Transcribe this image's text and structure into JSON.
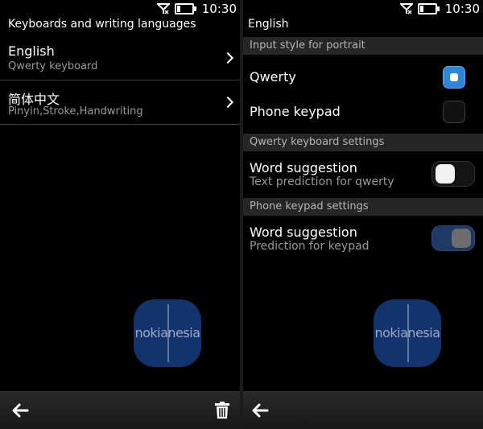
{
  "status": {
    "time": "10:30"
  },
  "left": {
    "title": "Keyboards and writing languages",
    "items": [
      {
        "label": "English",
        "sub": "Qwerty keyboard"
      },
      {
        "label": "简体中文",
        "sub": "Pinyin,Stroke,Handwriting"
      }
    ]
  },
  "right": {
    "title": "English",
    "sections": [
      {
        "header": "Input style for portrait"
      },
      {
        "header": "Qwerty keyboard settings"
      },
      {
        "header": "Phone keypad settings"
      }
    ],
    "input_style": [
      {
        "label": "Qwerty",
        "selected": true
      },
      {
        "label": "Phone keypad",
        "selected": false
      }
    ],
    "qwerty_settings": {
      "label": "Word suggestion",
      "sub": "Text prediction for qwerty",
      "on": false
    },
    "keypad_settings": {
      "label": "Word suggestion",
      "sub": "Prediction for keypad",
      "on": true
    }
  },
  "watermark": {
    "text": "nokianesia"
  },
  "icons": {
    "back": "back-arrow-icon",
    "delete": "trash-icon",
    "signal": "signal-icon",
    "battery": "battery-icon"
  },
  "colors": {
    "accent": "#2f86d6",
    "section_bg": "#262626",
    "toggle_on": "#1e3a64",
    "logo": "#173c80"
  }
}
